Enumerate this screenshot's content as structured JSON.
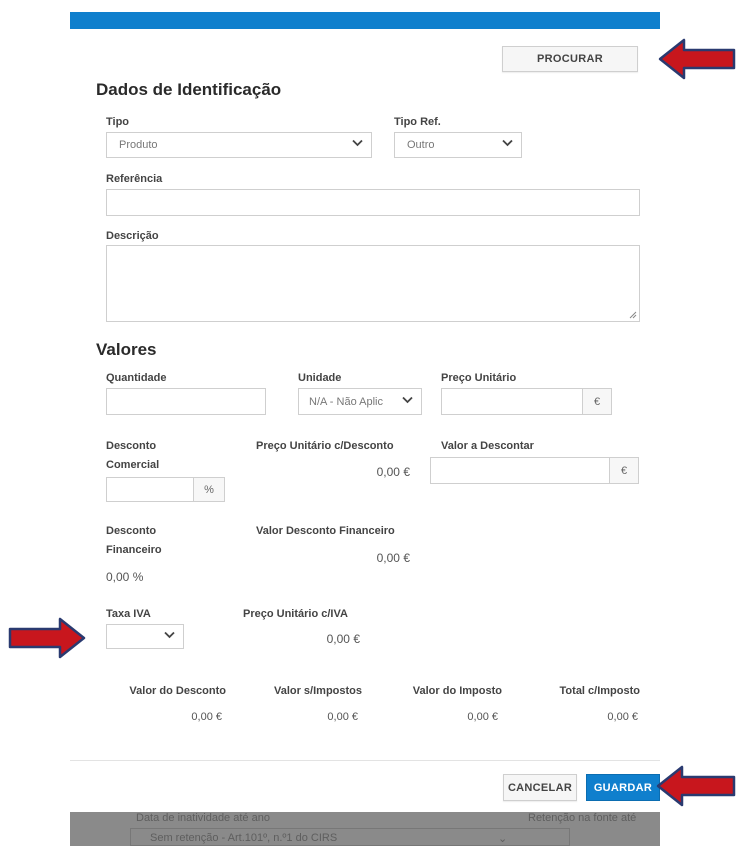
{
  "header": {
    "accent_color": "#0f7fcd"
  },
  "toolbar": {
    "search_label": "PROCURAR"
  },
  "identification": {
    "title": "Dados de Identificação",
    "tipo": {
      "label": "Tipo",
      "value": "Produto"
    },
    "tipo_ref": {
      "label": "Tipo Ref.",
      "value": "Outro"
    },
    "referencia": {
      "label": "Referência",
      "value": ""
    },
    "descricao": {
      "label": "Descrição",
      "value": ""
    }
  },
  "values": {
    "title": "Valores",
    "quantidade": {
      "label": "Quantidade",
      "value": ""
    },
    "unidade": {
      "label": "Unidade",
      "value": "N/A - Não Aplic"
    },
    "preco_unitario": {
      "label": "Preço Unitário",
      "value": "",
      "unit": "€"
    },
    "desconto_comercial": {
      "label_line1": "Desconto",
      "label_line2": "Comercial",
      "value": "",
      "unit": "%"
    },
    "preco_unitario_desconto": {
      "label": "Preço Unitário c/Desconto",
      "value": "0,00 €"
    },
    "valor_a_descontar": {
      "label": "Valor a Descontar",
      "value": "",
      "unit": "€"
    },
    "desconto_financeiro": {
      "label_line1": "Desconto",
      "label_line2": "Financeiro",
      "value": "0,00 %"
    },
    "valor_desconto_financeiro": {
      "label": "Valor Desconto Financeiro",
      "value": "0,00 €"
    },
    "taxa_iva": {
      "label": "Taxa IVA",
      "value": ""
    },
    "preco_unitario_iva": {
      "label": "Preço Unitário c/IVA",
      "value": "0,00 €"
    }
  },
  "totals": {
    "columns": [
      {
        "label": "Valor do Desconto",
        "value": "0,00 €"
      },
      {
        "label": "Valor s/Impostos",
        "value": "0,00 €"
      },
      {
        "label": "Valor do Imposto",
        "value": "0,00 €"
      },
      {
        "label": "Total c/Imposto",
        "value": "0,00 €"
      }
    ]
  },
  "footer": {
    "cancel_label": "CANCELAR",
    "save_label": "GUARDAR"
  },
  "background": {
    "left_label": "Data de inatividade até ano",
    "right_label": "Retenção na fonte até",
    "field_value": "Sem retenção - Art.101º, n.º1 do CIRS"
  },
  "annotations": {
    "arrow_color": "#c8161d",
    "arrow_outline": "#2a3a70"
  }
}
